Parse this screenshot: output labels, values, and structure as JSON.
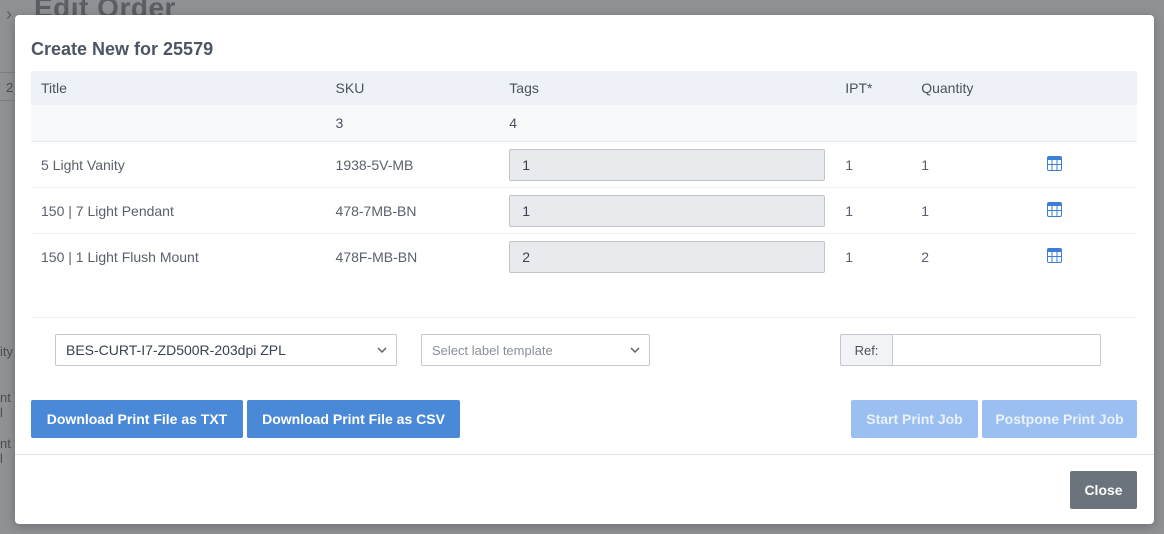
{
  "background": {
    "page_title": "Edit Order",
    "row_snippets": [
      "2",
      "ity",
      "nt l",
      "nt l"
    ]
  },
  "modal": {
    "title": "Create New for 25579",
    "table": {
      "headers": [
        "Title",
        "SKU",
        "Tags",
        "IPT*",
        "Quantity"
      ],
      "summary": {
        "sku": "3",
        "tags": "4"
      },
      "rows": [
        {
          "title": "5 Light Vanity",
          "sku": "1938-5V-MB",
          "tags": "1",
          "ipt": "1",
          "quantity": "1",
          "action_icon": "table-grid-icon"
        },
        {
          "title": "150 | 7 Light Pendant",
          "sku": "478-7MB-BN",
          "tags": "1",
          "ipt": "1",
          "quantity": "1",
          "action_icon": "table-grid-icon"
        },
        {
          "title": "150 | 1 Light Flush Mount",
          "sku": "478F-MB-BN",
          "tags": "2",
          "ipt": "1",
          "quantity": "2",
          "action_icon": "table-grid-icon"
        }
      ]
    },
    "printer_select": {
      "value": "BES-CURT-I7-ZD500R-203dpi ZPL"
    },
    "label_template_select": {
      "placeholder": "Select label template"
    },
    "ref": {
      "label": "Ref:",
      "value": ""
    },
    "buttons": {
      "download_txt": "Download Print File as TXT",
      "download_csv": "Download Print File as CSV",
      "start_print": "Start Print Job",
      "postpone_print": "Postpone Print Job",
      "close": "Close"
    }
  },
  "colors": {
    "primary": "#4a89d8",
    "disabled": "#9bbff0",
    "close": "#6b737c",
    "icon": "#3d7fd6"
  }
}
